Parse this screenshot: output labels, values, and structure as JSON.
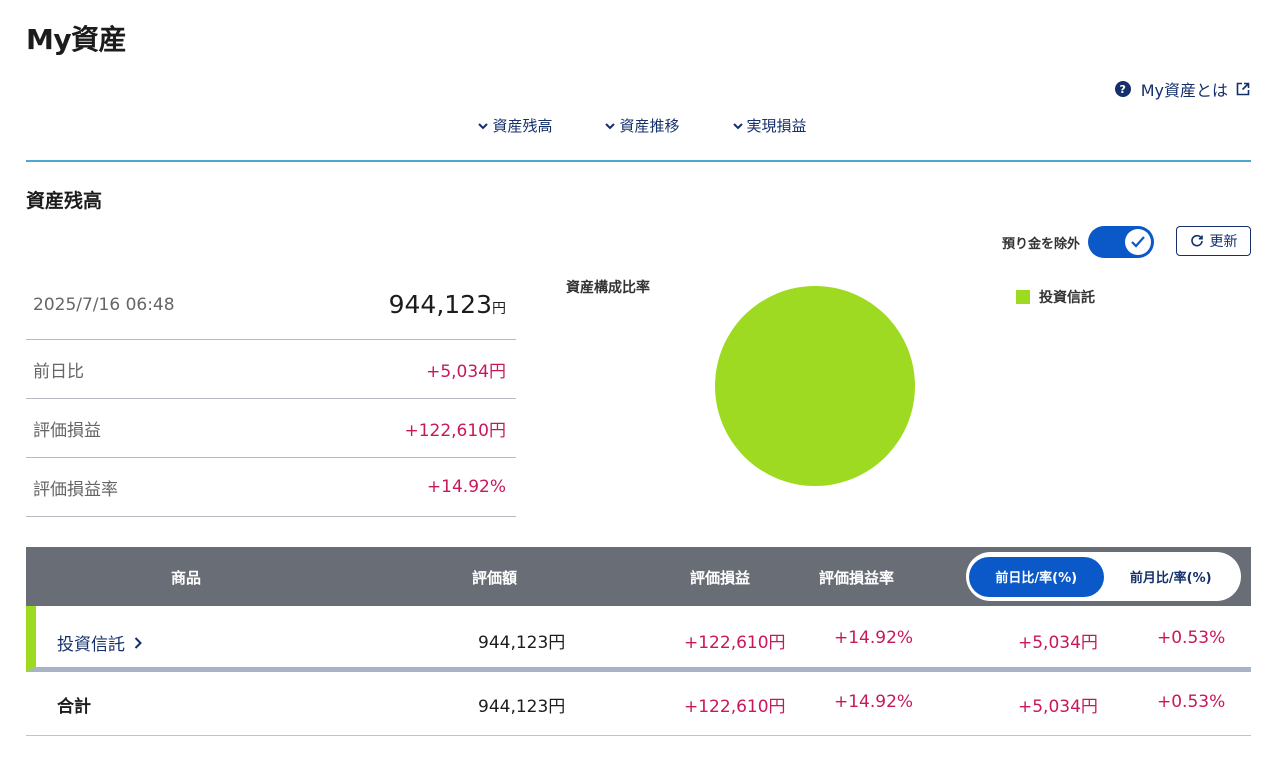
{
  "page": {
    "title": "My資産",
    "help_link": "My資産とは"
  },
  "nav": {
    "tabs": [
      {
        "label": "資産残高"
      },
      {
        "label": "資産推移"
      },
      {
        "label": "実現損益"
      }
    ]
  },
  "section": {
    "title": "資産残高",
    "toggle_label": "預り金を除外",
    "toggle_on": true,
    "refresh_label": "更新"
  },
  "summary": {
    "datetime": "2025/7/16 06:48",
    "total_value": "944,123",
    "yen_unit": "円",
    "rows": [
      {
        "label": "前日比",
        "value": "+5,034円"
      },
      {
        "label": "評価損益",
        "value": "+122,610円"
      },
      {
        "label": "評価損益率",
        "value": "+14.92%"
      }
    ]
  },
  "composition": {
    "title": "資産構成比率",
    "legend": [
      {
        "label": "投資信託",
        "color": "#9fda22"
      }
    ]
  },
  "chart_data": {
    "type": "pie",
    "title": "資産構成比率",
    "slices": [
      {
        "label": "投資信託",
        "value": 100,
        "color": "#9fda22"
      }
    ]
  },
  "table": {
    "headers": {
      "product": "商品",
      "value": "評価額",
      "gain": "評価損益",
      "rate": "評価損益率"
    },
    "segment": {
      "options": [
        "前日比/率(%)",
        "前月比/率(%)"
      ],
      "active_index": 0
    },
    "rows": [
      {
        "name": "投資信託",
        "value": "944,123円",
        "gain": "+122,610円",
        "rate": "+14.92%",
        "diff": "+5,034円",
        "diff_rate": "+0.53%"
      }
    ],
    "total": {
      "name": "合計",
      "value": "944,123円",
      "gain": "+122,610円",
      "rate": "+14.92%",
      "diff": "+5,034円",
      "diff_rate": "+0.53%"
    }
  },
  "colors": {
    "accent": "#0b58c8",
    "link": "#14306b",
    "positive": "#c8175b",
    "fund": "#9fda22",
    "header_bg": "#696e76",
    "divider": "#4fa7cf"
  }
}
